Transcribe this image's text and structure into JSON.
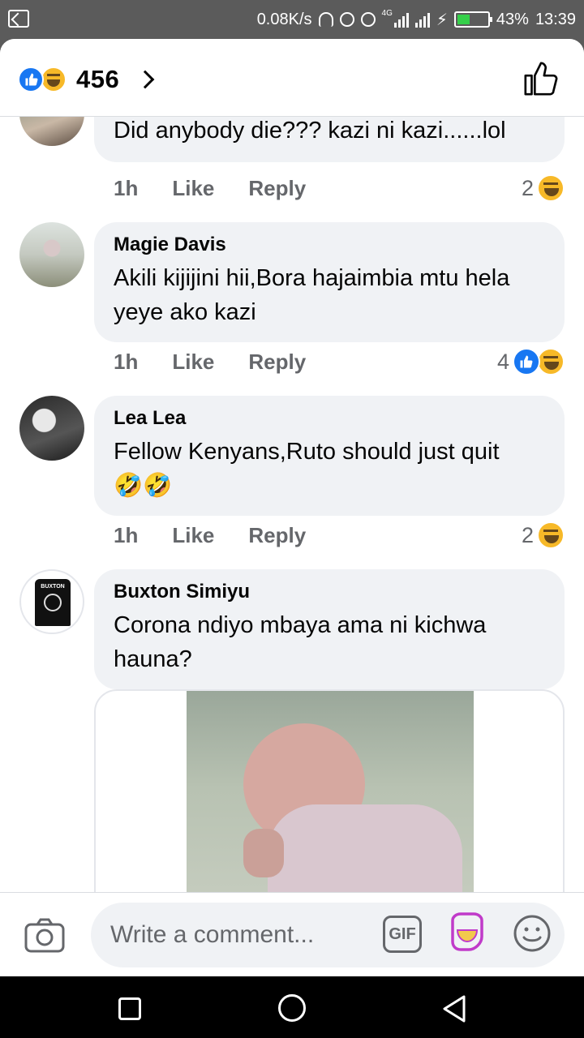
{
  "status_bar": {
    "speed": "0.08K/s",
    "network": "4G",
    "battery": "43%",
    "battery_level": 0.43,
    "time": "13:39"
  },
  "header": {
    "reactions": [
      "like",
      "haha"
    ],
    "reaction_count": "456",
    "icons": [
      "chevron-right-icon",
      "thumbs-up-icon"
    ]
  },
  "comments": [
    {
      "author": "",
      "text": "Did anybody die??? kazi ni kazi......lol",
      "time": "1h",
      "like_label": "Like",
      "reply_label": "Reply",
      "reaction_count": "2",
      "reactions": [
        "haha"
      ]
    },
    {
      "author": "Magie Davis",
      "text": "Akili kijijini hii,Bora hajaimbia mtu hela yeye ako kazi",
      "time": "1h",
      "like_label": "Like",
      "reply_label": "Reply",
      "reaction_count": "4",
      "reactions": [
        "like",
        "haha"
      ]
    },
    {
      "author": "Lea Lea",
      "text": "Fellow Kenyans,Ruto should just quit🤣🤣",
      "time": "1h",
      "like_label": "Like",
      "reply_label": "Reply",
      "reaction_count": "2",
      "reactions": [
        "haha"
      ]
    },
    {
      "author": "Buxton Simiyu",
      "text": "Corona ndiyo mbaya ama ni kichwa hauna?",
      "avatar_text": "BUXTON",
      "has_image": true
    }
  ],
  "composer": {
    "placeholder": "Write a comment...",
    "gif_label": "GIF",
    "icons": [
      "camera-icon",
      "gif-icon",
      "sticker-icon",
      "emoji-icon"
    ]
  },
  "nav_bar": {
    "icons": [
      "recent-apps-icon",
      "home-icon",
      "back-icon"
    ]
  },
  "colors": {
    "facebook_blue": "#1877f2",
    "haha_yellow": "#f7b928",
    "bubble_gray": "#f0f2f5",
    "meta_gray": "#65676b",
    "status_bar_gray": "#5b5b5b",
    "battery_green": "#35d04a"
  }
}
